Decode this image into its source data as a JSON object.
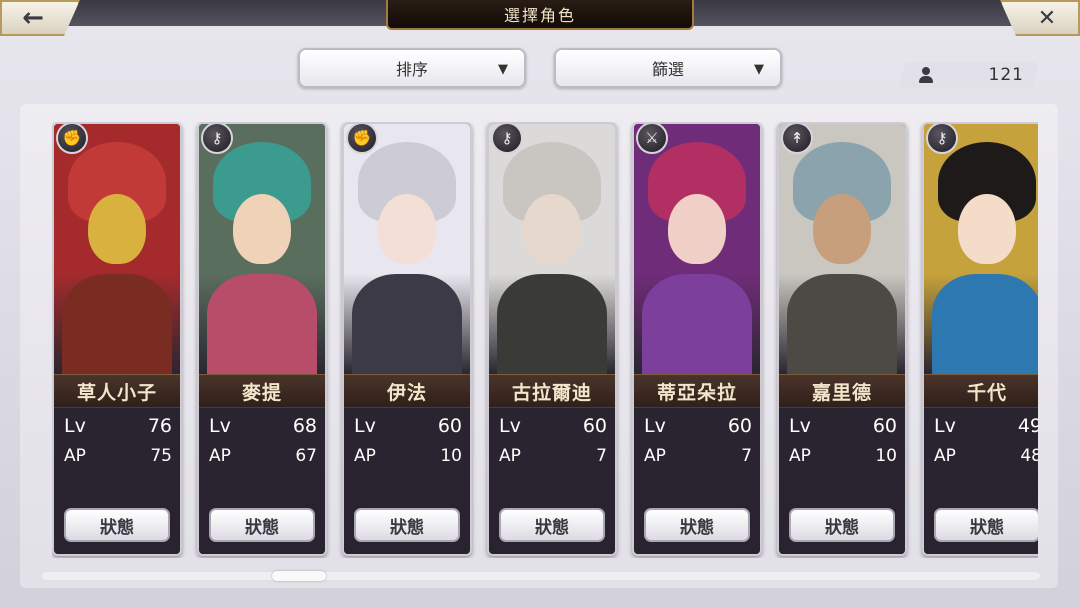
{
  "header": {
    "title": "選擇角色",
    "back_icon": "←",
    "close_icon": "✕"
  },
  "controls": {
    "sort_label": "排序",
    "filter_label": "篩選",
    "dropdown_arrow": "▼",
    "count": "121"
  },
  "characters": [
    {
      "name": "草人小子",
      "lv_label": "Lv",
      "lv": "76",
      "ap_label": "AP",
      "ap": "75",
      "status_label": "狀態",
      "type_icon": "fist-icon",
      "colors": {
        "bg": "#a42a2c",
        "hair": "#c23a37",
        "face": "#d8b13e",
        "body": "#7a2c22"
      }
    },
    {
      "name": "麥提",
      "lv_label": "Lv",
      "lv": "68",
      "ap_label": "AP",
      "ap": "67",
      "status_label": "狀態",
      "type_icon": "key-icon",
      "colors": {
        "bg": "#5a6e5e",
        "hair": "#3a9b8e",
        "face": "#f0d2b8",
        "body": "#b84d6a"
      }
    },
    {
      "name": "伊法",
      "lv_label": "Lv",
      "lv": "60",
      "ap_label": "AP",
      "ap": "10",
      "status_label": "狀態",
      "type_icon": "fist-icon",
      "colors": {
        "bg": "#e8e6ee",
        "hair": "#cdcbd4",
        "face": "#f3dfd6",
        "body": "#3c3a46"
      }
    },
    {
      "name": "古拉爾迪",
      "lv_label": "Lv",
      "lv": "60",
      "ap_label": "AP",
      "ap": "7",
      "status_label": "狀態",
      "type_icon": "key-icon",
      "colors": {
        "bg": "#dcdad8",
        "hair": "#c9c6c2",
        "face": "#e6d8cc",
        "body": "#3a3b36"
      }
    },
    {
      "name": "蒂亞朵拉",
      "lv_label": "Lv",
      "lv": "60",
      "ap_label": "AP",
      "ap": "7",
      "status_label": "狀態",
      "type_icon": "sword-icon",
      "colors": {
        "bg": "#6f2c78",
        "hair": "#b22f64",
        "face": "#f0cfc6",
        "body": "#7c3f9c"
      }
    },
    {
      "name": "嘉里德",
      "lv_label": "Lv",
      "lv": "60",
      "ap_label": "AP",
      "ap": "10",
      "status_label": "狀態",
      "type_icon": "spear-icon",
      "colors": {
        "bg": "#c9c7bf",
        "hair": "#8aa3ad",
        "face": "#c89f7c",
        "body": "#4b4a45"
      }
    },
    {
      "name": "千代",
      "lv_label": "Lv",
      "lv": "49",
      "ap_label": "AP",
      "ap": "48",
      "status_label": "狀態",
      "type_icon": "key-icon",
      "colors": {
        "bg": "#c6a23c",
        "hair": "#1e1a19",
        "face": "#f4dcc8",
        "body": "#2d78b0"
      }
    }
  ]
}
